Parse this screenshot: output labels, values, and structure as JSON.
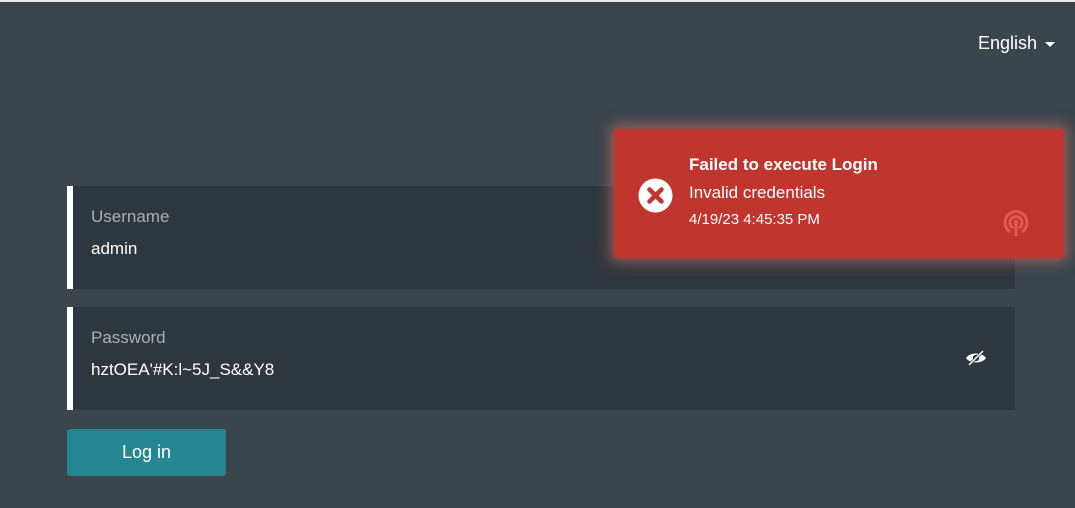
{
  "language": {
    "label": "English",
    "icon": "caret-down-icon"
  },
  "username": {
    "label": "Username",
    "value": "admin"
  },
  "password": {
    "label": "Password",
    "value": "hztOEA'#K:l~5J_S&&Y8",
    "toggle_icon": "eye-slash-icon"
  },
  "login_button": {
    "label": "Log in"
  },
  "toast": {
    "title": "Failed to execute Login",
    "message": "Invalid credentials",
    "timestamp": "4/19/23 4:45:35 PM",
    "status_icon": "error-x-icon",
    "source_icon": "broadcast-icon",
    "color": "#c0362f"
  },
  "colors": {
    "background": "#3a454c",
    "field_background": "#2f373e",
    "accent": "#258591"
  }
}
